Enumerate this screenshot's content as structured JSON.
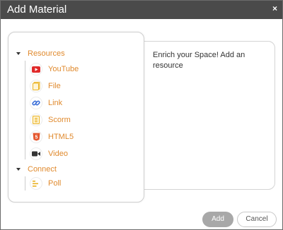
{
  "dialog": {
    "title": "Add Material",
    "close_glyph": "×"
  },
  "description": "Enrich your Space! Add an resource",
  "groups": [
    {
      "label": "Resources",
      "items": [
        {
          "label": "YouTube",
          "icon": "youtube-icon"
        },
        {
          "label": "File",
          "icon": "file-icon"
        },
        {
          "label": "Link",
          "icon": "link-icon"
        },
        {
          "label": "Scorm",
          "icon": "scorm-icon"
        },
        {
          "label": "HTML5",
          "icon": "html5-icon"
        },
        {
          "label": "Video",
          "icon": "video-icon"
        }
      ]
    },
    {
      "label": "Connect",
      "items": [
        {
          "label": "Poll",
          "icon": "poll-icon"
        }
      ]
    }
  ],
  "buttons": {
    "add": "Add",
    "cancel": "Cancel"
  },
  "colors": {
    "titlebar": "#4a4a4a",
    "accent": "#e08a2e",
    "youtube": "#e02a2a",
    "file": "#e8b020",
    "link": "#3b6fd8",
    "html5": "#e4572e",
    "video": "#333333",
    "add_button": "#a8a8a8"
  }
}
